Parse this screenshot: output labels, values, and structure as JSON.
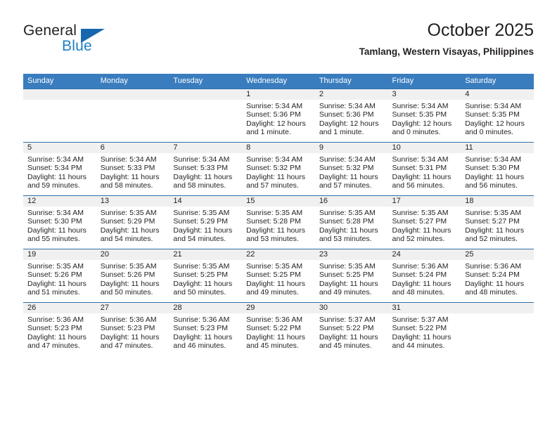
{
  "brand": {
    "name_part1": "General",
    "name_part2": "Blue",
    "logo_icon": "triangle-flag-icon"
  },
  "header": {
    "title": "October 2025",
    "subtitle": "Tamlang, Western Visayas, Philippines"
  },
  "colors": {
    "header_bar": "#3a7dbf",
    "grid_line": "#2f6ea8",
    "daynum_band": "#f0f0f0",
    "brand_blue": "#1c7fc3",
    "brand_dark": "#231f20"
  },
  "weekday_headers": [
    "Sunday",
    "Monday",
    "Tuesday",
    "Wednesday",
    "Thursday",
    "Friday",
    "Saturday"
  ],
  "labels": {
    "sunrise_prefix": "Sunrise:",
    "sunset_prefix": "Sunset:",
    "daylight_prefix": "Daylight:"
  },
  "weeks": [
    [
      {
        "day": "",
        "empty": true,
        "line1": "",
        "line2": "",
        "line3": "",
        "line4": ""
      },
      {
        "day": "",
        "empty": true,
        "line1": "",
        "line2": "",
        "line3": "",
        "line4": ""
      },
      {
        "day": "",
        "empty": true,
        "line1": "",
        "line2": "",
        "line3": "",
        "line4": ""
      },
      {
        "day": "1",
        "empty": false,
        "line1": "Sunrise: 5:34 AM",
        "line2": "Sunset: 5:36 PM",
        "line3": "Daylight: 12 hours",
        "line4": "and 1 minute."
      },
      {
        "day": "2",
        "empty": false,
        "line1": "Sunrise: 5:34 AM",
        "line2": "Sunset: 5:36 PM",
        "line3": "Daylight: 12 hours",
        "line4": "and 1 minute."
      },
      {
        "day": "3",
        "empty": false,
        "line1": "Sunrise: 5:34 AM",
        "line2": "Sunset: 5:35 PM",
        "line3": "Daylight: 12 hours",
        "line4": "and 0 minutes."
      },
      {
        "day": "4",
        "empty": false,
        "line1": "Sunrise: 5:34 AM",
        "line2": "Sunset: 5:35 PM",
        "line3": "Daylight: 12 hours",
        "line4": "and 0 minutes."
      }
    ],
    [
      {
        "day": "5",
        "empty": false,
        "line1": "Sunrise: 5:34 AM",
        "line2": "Sunset: 5:34 PM",
        "line3": "Daylight: 11 hours",
        "line4": "and 59 minutes."
      },
      {
        "day": "6",
        "empty": false,
        "line1": "Sunrise: 5:34 AM",
        "line2": "Sunset: 5:33 PM",
        "line3": "Daylight: 11 hours",
        "line4": "and 58 minutes."
      },
      {
        "day": "7",
        "empty": false,
        "line1": "Sunrise: 5:34 AM",
        "line2": "Sunset: 5:33 PM",
        "line3": "Daylight: 11 hours",
        "line4": "and 58 minutes."
      },
      {
        "day": "8",
        "empty": false,
        "line1": "Sunrise: 5:34 AM",
        "line2": "Sunset: 5:32 PM",
        "line3": "Daylight: 11 hours",
        "line4": "and 57 minutes."
      },
      {
        "day": "9",
        "empty": false,
        "line1": "Sunrise: 5:34 AM",
        "line2": "Sunset: 5:32 PM",
        "line3": "Daylight: 11 hours",
        "line4": "and 57 minutes."
      },
      {
        "day": "10",
        "empty": false,
        "line1": "Sunrise: 5:34 AM",
        "line2": "Sunset: 5:31 PM",
        "line3": "Daylight: 11 hours",
        "line4": "and 56 minutes."
      },
      {
        "day": "11",
        "empty": false,
        "line1": "Sunrise: 5:34 AM",
        "line2": "Sunset: 5:30 PM",
        "line3": "Daylight: 11 hours",
        "line4": "and 56 minutes."
      }
    ],
    [
      {
        "day": "12",
        "empty": false,
        "line1": "Sunrise: 5:34 AM",
        "line2": "Sunset: 5:30 PM",
        "line3": "Daylight: 11 hours",
        "line4": "and 55 minutes."
      },
      {
        "day": "13",
        "empty": false,
        "line1": "Sunrise: 5:35 AM",
        "line2": "Sunset: 5:29 PM",
        "line3": "Daylight: 11 hours",
        "line4": "and 54 minutes."
      },
      {
        "day": "14",
        "empty": false,
        "line1": "Sunrise: 5:35 AM",
        "line2": "Sunset: 5:29 PM",
        "line3": "Daylight: 11 hours",
        "line4": "and 54 minutes."
      },
      {
        "day": "15",
        "empty": false,
        "line1": "Sunrise: 5:35 AM",
        "line2": "Sunset: 5:28 PM",
        "line3": "Daylight: 11 hours",
        "line4": "and 53 minutes."
      },
      {
        "day": "16",
        "empty": false,
        "line1": "Sunrise: 5:35 AM",
        "line2": "Sunset: 5:28 PM",
        "line3": "Daylight: 11 hours",
        "line4": "and 53 minutes."
      },
      {
        "day": "17",
        "empty": false,
        "line1": "Sunrise: 5:35 AM",
        "line2": "Sunset: 5:27 PM",
        "line3": "Daylight: 11 hours",
        "line4": "and 52 minutes."
      },
      {
        "day": "18",
        "empty": false,
        "line1": "Sunrise: 5:35 AM",
        "line2": "Sunset: 5:27 PM",
        "line3": "Daylight: 11 hours",
        "line4": "and 52 minutes."
      }
    ],
    [
      {
        "day": "19",
        "empty": false,
        "line1": "Sunrise: 5:35 AM",
        "line2": "Sunset: 5:26 PM",
        "line3": "Daylight: 11 hours",
        "line4": "and 51 minutes."
      },
      {
        "day": "20",
        "empty": false,
        "line1": "Sunrise: 5:35 AM",
        "line2": "Sunset: 5:26 PM",
        "line3": "Daylight: 11 hours",
        "line4": "and 50 minutes."
      },
      {
        "day": "21",
        "empty": false,
        "line1": "Sunrise: 5:35 AM",
        "line2": "Sunset: 5:25 PM",
        "line3": "Daylight: 11 hours",
        "line4": "and 50 minutes."
      },
      {
        "day": "22",
        "empty": false,
        "line1": "Sunrise: 5:35 AM",
        "line2": "Sunset: 5:25 PM",
        "line3": "Daylight: 11 hours",
        "line4": "and 49 minutes."
      },
      {
        "day": "23",
        "empty": false,
        "line1": "Sunrise: 5:35 AM",
        "line2": "Sunset: 5:25 PM",
        "line3": "Daylight: 11 hours",
        "line4": "and 49 minutes."
      },
      {
        "day": "24",
        "empty": false,
        "line1": "Sunrise: 5:36 AM",
        "line2": "Sunset: 5:24 PM",
        "line3": "Daylight: 11 hours",
        "line4": "and 48 minutes."
      },
      {
        "day": "25",
        "empty": false,
        "line1": "Sunrise: 5:36 AM",
        "line2": "Sunset: 5:24 PM",
        "line3": "Daylight: 11 hours",
        "line4": "and 48 minutes."
      }
    ],
    [
      {
        "day": "26",
        "empty": false,
        "line1": "Sunrise: 5:36 AM",
        "line2": "Sunset: 5:23 PM",
        "line3": "Daylight: 11 hours",
        "line4": "and 47 minutes."
      },
      {
        "day": "27",
        "empty": false,
        "line1": "Sunrise: 5:36 AM",
        "line2": "Sunset: 5:23 PM",
        "line3": "Daylight: 11 hours",
        "line4": "and 47 minutes."
      },
      {
        "day": "28",
        "empty": false,
        "line1": "Sunrise: 5:36 AM",
        "line2": "Sunset: 5:23 PM",
        "line3": "Daylight: 11 hours",
        "line4": "and 46 minutes."
      },
      {
        "day": "29",
        "empty": false,
        "line1": "Sunrise: 5:36 AM",
        "line2": "Sunset: 5:22 PM",
        "line3": "Daylight: 11 hours",
        "line4": "and 45 minutes."
      },
      {
        "day": "30",
        "empty": false,
        "line1": "Sunrise: 5:37 AM",
        "line2": "Sunset: 5:22 PM",
        "line3": "Daylight: 11 hours",
        "line4": "and 45 minutes."
      },
      {
        "day": "31",
        "empty": false,
        "line1": "Sunrise: 5:37 AM",
        "line2": "Sunset: 5:22 PM",
        "line3": "Daylight: 11 hours",
        "line4": "and 44 minutes."
      },
      {
        "day": "",
        "empty": true,
        "line1": "",
        "line2": "",
        "line3": "",
        "line4": ""
      }
    ]
  ]
}
